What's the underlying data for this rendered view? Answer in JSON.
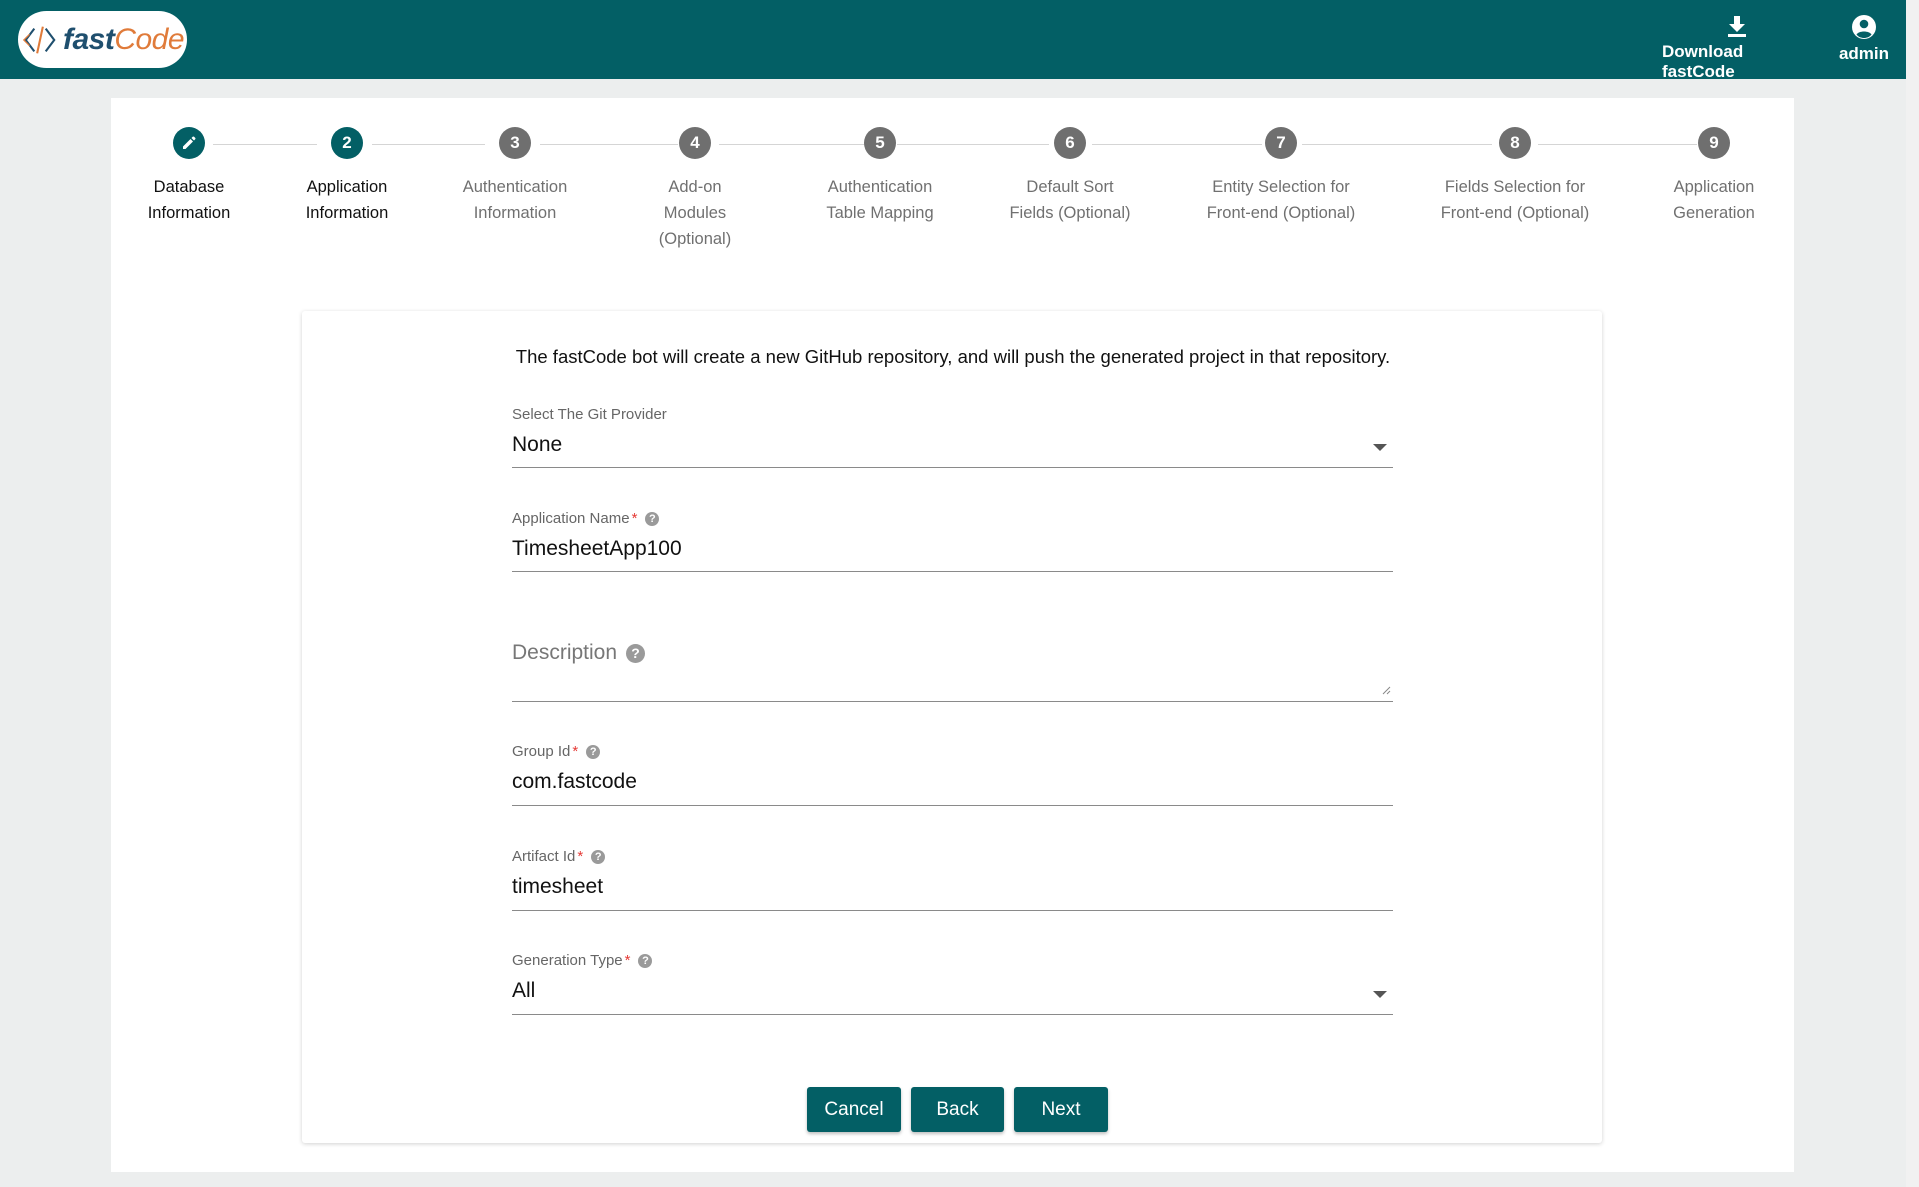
{
  "header": {
    "logo_text_fast": "fast",
    "logo_text_code": "Code",
    "download_label": "Download fastCode",
    "user_label": "admin"
  },
  "stepper": {
    "steps": [
      {
        "number": "",
        "label": "Database\nInformation",
        "state": "completed"
      },
      {
        "number": "2",
        "label": "Application\nInformation",
        "state": "active"
      },
      {
        "number": "3",
        "label": "Authentication\nInformation",
        "state": "pending"
      },
      {
        "number": "4",
        "label": "Add-on\nModules\n(Optional)",
        "state": "pending"
      },
      {
        "number": "5",
        "label": "Authentication\nTable Mapping",
        "state": "pending"
      },
      {
        "number": "6",
        "label": "Default Sort\nFields (Optional)",
        "state": "pending"
      },
      {
        "number": "7",
        "label": "Entity Selection for\nFront-end (Optional)",
        "state": "pending"
      },
      {
        "number": "8",
        "label": "Fields Selection for\nFront-end (Optional)",
        "state": "pending"
      },
      {
        "number": "9",
        "label": "Application\nGeneration",
        "state": "pending"
      }
    ]
  },
  "form": {
    "intro": "The fastCode bot will create a new GitHub repository, and will push the generated project in that repository.",
    "git_provider": {
      "label": "Select The Git Provider",
      "value": "None"
    },
    "app_name": {
      "label": "Application Name",
      "required": "*",
      "value": "TimesheetApp100"
    },
    "description": {
      "label": "Description",
      "value": ""
    },
    "group_id": {
      "label": "Group Id",
      "required": "*",
      "value": "com.fastcode"
    },
    "artifact_id": {
      "label": "Artifact Id",
      "required": "*",
      "value": "timesheet"
    },
    "generation_type": {
      "label": "Generation Type",
      "required": "*",
      "value": "All"
    },
    "help_glyph": "?"
  },
  "buttons": {
    "cancel": "Cancel",
    "back": "Back",
    "next": "Next"
  },
  "colors": {
    "primary": "#035f65",
    "step_pending": "#6f6f6f",
    "required": "#e53935"
  },
  "icons": {
    "logo": "code-brackets-icon",
    "download": "download-icon",
    "user": "account-circle-icon",
    "completed_step": "pencil-icon",
    "help": "help-circle-icon",
    "dropdown": "caret-down-icon"
  }
}
